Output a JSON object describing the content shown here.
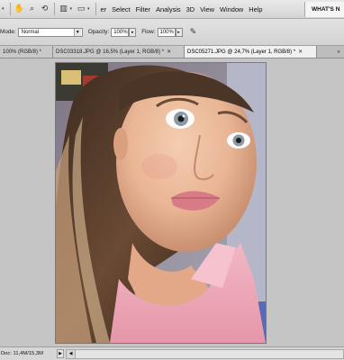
{
  "menubar": {
    "items": [
      "er",
      "Select",
      "Filter",
      "Analysis",
      "3D",
      "View",
      "Window",
      "Help"
    ],
    "workspace_label": "WHAT'S N"
  },
  "options": {
    "mode_label": "Mode:",
    "mode_value": "Normal",
    "opacity_label": "Opacity:",
    "opacity_value": "100%",
    "flow_label": "Flow:",
    "flow_value": "100%"
  },
  "tabs": [
    {
      "label": "100% (RGB/8) *",
      "active": false
    },
    {
      "label": "DSC03318.JPG @ 16,5% (Layer 1, RGB/8) *",
      "active": false
    },
    {
      "label": "DSC05271.JPG @ 24,7% (Layer 1, RGB/8) *",
      "active": true
    }
  ],
  "status": {
    "doc": "Doc: 11,4M/15,3M"
  },
  "icons": {
    "hand": "hand-tool-icon",
    "zoom": "zoom-tool-icon",
    "rotate": "rotate-view-icon",
    "arrange": "arrange-documents-icon",
    "screen": "screen-mode-icon",
    "airbrush": "airbrush-icon"
  }
}
